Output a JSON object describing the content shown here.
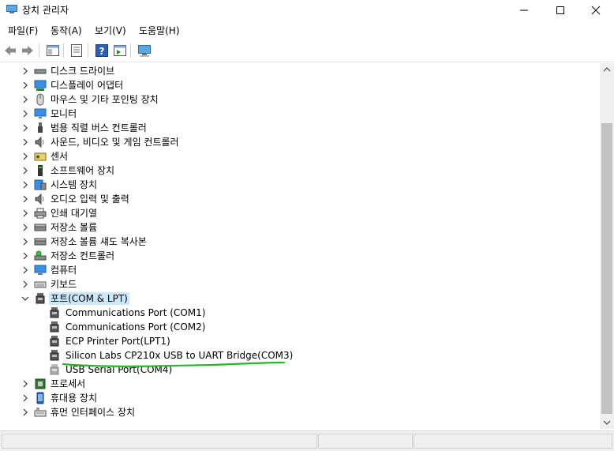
{
  "window": {
    "title": "장치 관리자"
  },
  "menu": [
    {
      "label": "파일(F)"
    },
    {
      "label": "동작(A)"
    },
    {
      "label": "보기(V)"
    },
    {
      "label": "도움말(H)"
    }
  ],
  "tree": [
    {
      "label": "디스크 드라이브",
      "icon": "disk-drive-icon",
      "expanded": false,
      "level": 0
    },
    {
      "label": "디스플레이 어댑터",
      "icon": "display-adapter-icon",
      "expanded": false,
      "level": 0
    },
    {
      "label": "마우스 및 기타 포인팅 장치",
      "icon": "mouse-icon",
      "expanded": false,
      "level": 0
    },
    {
      "label": "모니터",
      "icon": "monitor-icon",
      "expanded": false,
      "level": 0
    },
    {
      "label": "범용 직렬 버스 컨트롤러",
      "icon": "usb-icon",
      "expanded": false,
      "level": 0
    },
    {
      "label": "사운드, 비디오 및 게임 컨트롤러",
      "icon": "speaker-icon",
      "expanded": false,
      "level": 0
    },
    {
      "label": "센서",
      "icon": "sensor-icon",
      "expanded": false,
      "level": 0
    },
    {
      "label": "소프트웨어 장치",
      "icon": "software-device-icon",
      "expanded": false,
      "level": 0
    },
    {
      "label": "시스템 장치",
      "icon": "system-device-icon",
      "expanded": false,
      "level": 0
    },
    {
      "label": "오디오 입력 및 출력",
      "icon": "speaker-icon",
      "expanded": false,
      "level": 0
    },
    {
      "label": "인쇄 대기열",
      "icon": "printer-icon",
      "expanded": false,
      "level": 0
    },
    {
      "label": "저장소 볼륨",
      "icon": "storage-volume-icon",
      "expanded": false,
      "level": 0
    },
    {
      "label": "저장소 볼륨 섀도 복사본",
      "icon": "storage-volume-icon",
      "expanded": false,
      "level": 0
    },
    {
      "label": "저장소 컨트롤러",
      "icon": "storage-controller-icon",
      "expanded": false,
      "level": 0
    },
    {
      "label": "컴퓨터",
      "icon": "computer-icon",
      "expanded": false,
      "level": 0
    },
    {
      "label": "키보드",
      "icon": "keyboard-icon",
      "expanded": false,
      "level": 0
    },
    {
      "label": "포트(COM & LPT)",
      "icon": "port-icon",
      "expanded": true,
      "level": 0,
      "selected": true
    },
    {
      "label": "Communications Port (COM1)",
      "icon": "port-icon",
      "level": 1
    },
    {
      "label": "Communications Port (COM2)",
      "icon": "port-icon",
      "level": 1
    },
    {
      "label": "ECP Printer Port(LPT1)",
      "icon": "port-icon",
      "level": 1
    },
    {
      "label": "Silicon Labs CP210x USB to UART Bridge(COM3)",
      "icon": "port-icon",
      "level": 1
    },
    {
      "label": "USB Serial Port(COM4)",
      "icon": "port-icon-disabled",
      "level": 1
    },
    {
      "label": "프로세서",
      "icon": "processor-icon",
      "expanded": false,
      "level": 0
    },
    {
      "label": "휴대용 장치",
      "icon": "portable-device-icon",
      "expanded": false,
      "level": 0
    },
    {
      "label": "휴먼 인터페이스 장치",
      "icon": "hid-icon",
      "expanded": false,
      "level": 0
    }
  ],
  "colors": {
    "selection": "#cce8ff",
    "annotation": "#22bb22",
    "scroll_thumb": "#c2c2c2"
  }
}
